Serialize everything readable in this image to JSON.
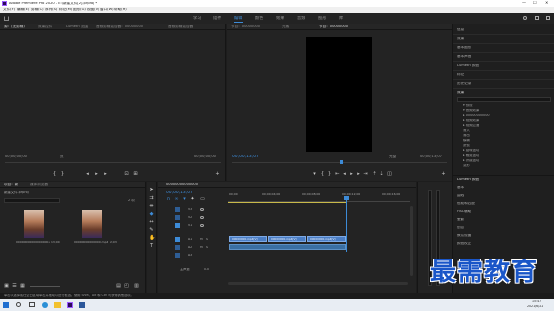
{
  "window": {
    "title": "Adobe Premiere Pro 2020 - E:\\新建文件[2].prproj *",
    "min": "—",
    "max": "☐",
    "close": "✕"
  },
  "menu": [
    "文件(F)",
    "编辑(E)",
    "剪辑(C)",
    "序列(S)",
    "标记(M)",
    "图形(G)",
    "视图(V)",
    "窗口(W)",
    "帮助(H)"
  ],
  "workspaces": [
    "学习",
    "组件",
    "编辑",
    "颜色",
    "效果",
    "音频",
    "图形",
    "库"
  ],
  "workspaces_active": 2,
  "source_monitor": {
    "tabs": [
      "源：(无剪辑)",
      "效果控件",
      "Lumetri 范围",
      "音频剪辑混合器：00000000",
      "音频剪辑混合器"
    ],
    "timecode_left": "00;00;00;00",
    "timecode_right": "00;00;00;00",
    "page": "页"
  },
  "program_monitor": {
    "tabs": [
      "节目：00000000",
      "元素",
      "节目：00000000"
    ],
    "timecode_left": "00;00;13;07",
    "fit": "完整",
    "timecode_right": "00;00;13;07"
  },
  "right_panel": {
    "items": [
      "信息",
      "效果",
      "基本图形",
      "基本声音",
      "Lumetri 颜色",
      "标记",
      "历史记录",
      "效果"
    ],
    "search_placeholder": "",
    "tree": [
      "▾ 预设",
      "▾ 音频效果",
      "▸ 00000000000",
      "▸ 视频效果",
      "▸ 视频过渡",
      "  渐入",
      "  渐出",
      "  模糊",
      "  滤镜",
      "▸ 旋转运动",
      "▸ 裁剪运动",
      "▸ 拼接运动",
      "  变形"
    ],
    "lower_title": "Lumetri 颜色",
    "lower_items": [
      "基本",
      "曲线",
      "色轮和匹配",
      "HSL辅助",
      "晕影",
      "创意",
      "默认设置",
      "颜色校正"
    ]
  },
  "project": {
    "tabs": [
      "项目：新",
      "媒体浏览器"
    ],
    "path": "新建文件.prproj",
    "count": "2 项",
    "search_placeholder": "",
    "items": [
      {
        "name": "00000000000000000.mp4",
        "duration": "13;00"
      },
      {
        "name": "00000000000000.mp4",
        "duration": "2;03"
      }
    ]
  },
  "timeline": {
    "tab": "00000000000000",
    "timecode": "00;00;13;07",
    "ruler": [
      "00;00",
      "00;00;04;00",
      "00;00;08;00",
      "00;00;12;00",
      "00;00;16;00"
    ],
    "tracks_video": [
      "V3",
      "V2",
      "V1"
    ],
    "tracks_audio": [
      "A1",
      "A2",
      "A3"
    ],
    "master": "主声道",
    "master_value": "0.0",
    "clips": [
      {
        "label": "00000000.mp4[V]",
        "kind": "v"
      },
      {
        "label": "00000000.mp4[V]",
        "kind": "v"
      },
      {
        "label": "00000000.mp4[V]",
        "kind": "v"
      }
    ]
  },
  "status": {
    "text": "单击以选择或在空白区域单击并拖动以进行框选。使用 Shift、Alt 和 Ctrl 可获得其他选项。"
  },
  "taskbar": {
    "time": "15:47",
    "date": "2021/6/22"
  },
  "watermark": "最需教育",
  "colors": {
    "accent": "#3d8bd7",
    "playhead": "#3d8bd7",
    "clip_video": "#4b7ec5",
    "clip_audio": "#3a6fa3",
    "panel_bg": "#232323",
    "watermark": "#1a56c8"
  }
}
